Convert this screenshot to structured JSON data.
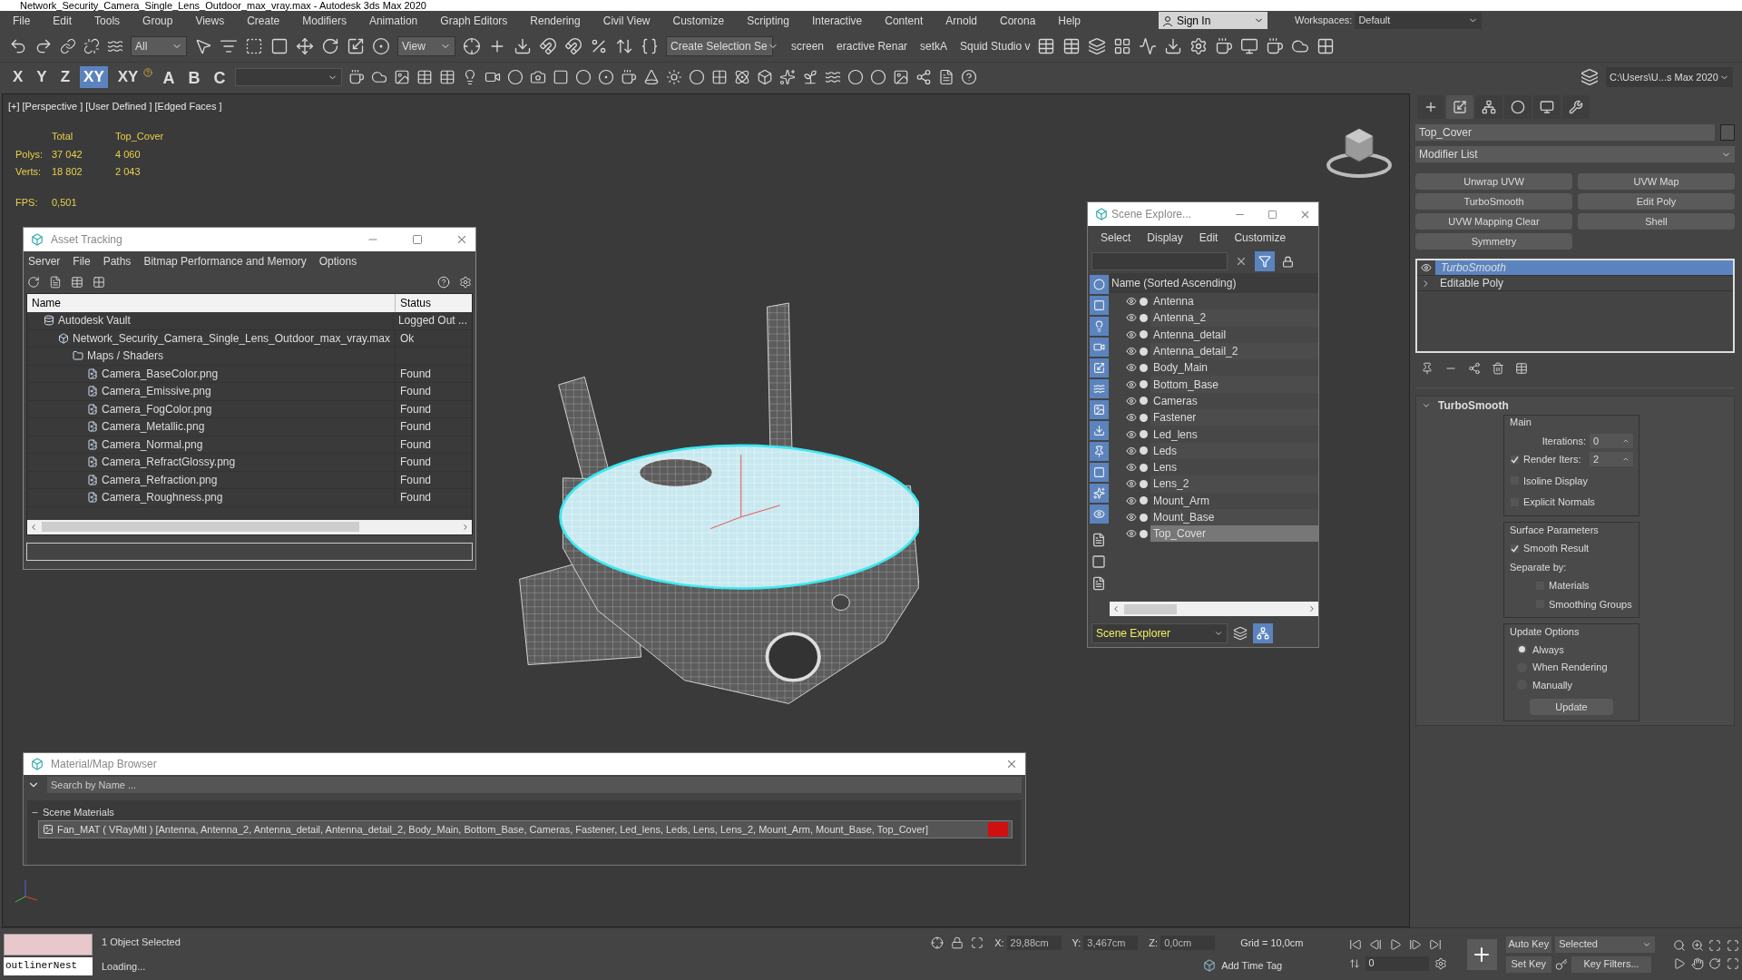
{
  "window": {
    "title": "Network_Security_Camera_Single_Lens_Outdoor_max_vray.max - Autodesk 3ds Max 2020"
  },
  "menu": [
    "File",
    "Edit",
    "Tools",
    "Group",
    "Views",
    "Create",
    "Modifiers",
    "Animation",
    "Graph Editors",
    "Rendering",
    "Civil View",
    "Customize",
    "Scripting",
    "Interactive",
    "Content",
    "Arnold",
    "Corona",
    "Help"
  ],
  "sign_in": "Sign In",
  "workspaces": {
    "label": "Workspaces:",
    "value": "Default"
  },
  "toolbar": {
    "selection_filter": "All",
    "reference_coord": "View",
    "named_selection": "Create Selection Se",
    "tabs": [
      "screen",
      "eractive Renar",
      "setkA",
      "Squid Studio v"
    ],
    "axis_buttons": [
      {
        "label": "X",
        "selected": false
      },
      {
        "label": "Y",
        "selected": false
      },
      {
        "label": "Z",
        "selected": false
      },
      {
        "label": "XY",
        "selected": true
      },
      {
        "label": "XY",
        "selected": false
      }
    ],
    "letter_buttons": [
      "A",
      "B",
      "C"
    ],
    "project_path": "C:\\Users\\U...s Max 2020"
  },
  "viewport": {
    "labels": [
      "[+]",
      "[Perspective ]",
      "[User Defined ]",
      "[Edged Faces ]"
    ],
    "stats_headers": [
      "Total",
      "Top_Cover"
    ],
    "stats": [
      {
        "label": "Polys:",
        "total": "37 042",
        "selection": "4 060"
      },
      {
        "label": "Verts:",
        "total": "18 802",
        "selection": "2 043"
      }
    ],
    "fps": {
      "label": "FPS:",
      "value": "0,501"
    }
  },
  "asset_tracking": {
    "title": "Asset Tracking",
    "menu": [
      "Server",
      "File",
      "Paths",
      "Bitmap Performance and Memory",
      "Options"
    ],
    "columns": [
      "Name",
      "Status"
    ],
    "rows": [
      {
        "name": "Autodesk Vault",
        "status": "Logged Out ...",
        "kind": "vault",
        "children": [
          {
            "name": "Network_Security_Camera_Single_Lens_Outdoor_max_vray.max",
            "status": "Ok",
            "kind": "scene",
            "children": [
              {
                "name": "Maps / Shaders",
                "kind": "folder",
                "children": [
                  {
                    "name": "Camera_BaseColor.png",
                    "status": "Found",
                    "kind": "file"
                  },
                  {
                    "name": "Camera_Emissive.png",
                    "status": "Found",
                    "kind": "file"
                  },
                  {
                    "name": "Camera_FogColor.png",
                    "status": "Found",
                    "kind": "file"
                  },
                  {
                    "name": "Camera_Metallic.png",
                    "status": "Found",
                    "kind": "file"
                  },
                  {
                    "name": "Camera_Normal.png",
                    "status": "Found",
                    "kind": "file"
                  },
                  {
                    "name": "Camera_RefractGlossy.png",
                    "status": "Found",
                    "kind": "file"
                  },
                  {
                    "name": "Camera_Refraction.png",
                    "status": "Found",
                    "kind": "file"
                  },
                  {
                    "name": "Camera_Roughness.png",
                    "status": "Found",
                    "kind": "file"
                  }
                ]
              }
            ]
          }
        ]
      }
    ]
  },
  "scene_explorer": {
    "title": "Scene Explore...",
    "menu": [
      "Select",
      "Display",
      "Edit",
      "Customize"
    ],
    "column": "Name (Sorted Ascending)",
    "items": [
      {
        "name": "Antenna",
        "selected": false
      },
      {
        "name": "Antenna_2",
        "selected": false
      },
      {
        "name": "Antenna_detail",
        "selected": false
      },
      {
        "name": "Antenna_detail_2",
        "selected": false
      },
      {
        "name": "Body_Main",
        "selected": false
      },
      {
        "name": "Bottom_Base",
        "selected": false
      },
      {
        "name": "Cameras",
        "selected": false
      },
      {
        "name": "Fastener",
        "selected": false
      },
      {
        "name": "Led_lens",
        "selected": false
      },
      {
        "name": "Leds",
        "selected": false
      },
      {
        "name": "Lens",
        "selected": false
      },
      {
        "name": "Lens_2",
        "selected": false
      },
      {
        "name": "Mount_Arm",
        "selected": false
      },
      {
        "name": "Mount_Base",
        "selected": false
      },
      {
        "name": "Top_Cover",
        "selected": true
      }
    ],
    "footer": "Scene Explorer"
  },
  "material_browser": {
    "title": "Material/Map Browser",
    "search_placeholder": "Search by Name ...",
    "group": "Scene Materials",
    "item": "Fan_MAT ( VRayMtl ) [Antenna, Antenna_2, Antenna_detail, Antenna_detail_2, Body_Main, Bottom_Base, Cameras, Fastener, Led_lens, Leds, Lens, Lens_2, Mount_Arm, Mount_Base, Top_Cover]"
  },
  "command_panel": {
    "tabs": [
      {
        "selected": false
      },
      {
        "selected": true
      },
      {
        "selected": false
      },
      {
        "selected": false
      },
      {
        "selected": false
      },
      {
        "selected": false
      }
    ],
    "object_name": "Top_Cover",
    "modifier_list": "Modifier List",
    "modifier_buttons": [
      "Unwrap UVW",
      "UVW Map",
      "TurboSmooth",
      "Edit Poly",
      "UVW Mapping Clear",
      "Shell",
      "Symmetry"
    ],
    "stack": [
      {
        "label": "TurboSmooth",
        "selected": true
      },
      {
        "label": "Editable Poly",
        "selected": false
      }
    ],
    "rollout": {
      "title": "TurboSmooth",
      "main": {
        "title": "Main",
        "iterations_label": "Iterations:",
        "iterations": "0",
        "render_iters_label": "Render Iters:",
        "render_iters": "2",
        "render_iters_checked": true,
        "options": [
          {
            "label": "Isoline Display",
            "checked": false
          },
          {
            "label": "Explicit Normals",
            "checked": false
          }
        ]
      },
      "surface": {
        "title": "Surface Parameters",
        "smooth_result": {
          "label": "Smooth Result",
          "checked": true
        },
        "separate_by": "Separate by:",
        "options": [
          {
            "label": "Materials",
            "checked": false
          },
          {
            "label": "Smoothing Groups",
            "checked": false
          }
        ]
      },
      "update": {
        "title": "Update Options",
        "options": [
          {
            "label": "Always",
            "selected": true
          },
          {
            "label": "When Rendering",
            "selected": false
          },
          {
            "label": "Manually",
            "selected": false
          }
        ],
        "button": "Update"
      }
    }
  },
  "status_bar": {
    "script_field": "outlinerNest",
    "selection": "1 Object Selected",
    "prompt": "Loading...",
    "coords": [
      {
        "label": "X:",
        "value": "29,88cm"
      },
      {
        "label": "Y:",
        "value": "3,467cm"
      },
      {
        "label": "Z:",
        "value": "0,0cm"
      }
    ],
    "grid": "Grid = 10,0cm",
    "time_tag": "Add Time Tag",
    "frame": "0",
    "auto_key": "Auto Key",
    "key_mode": "Selected",
    "set_key": "Set Key",
    "key_filters": "Key Filters..."
  }
}
